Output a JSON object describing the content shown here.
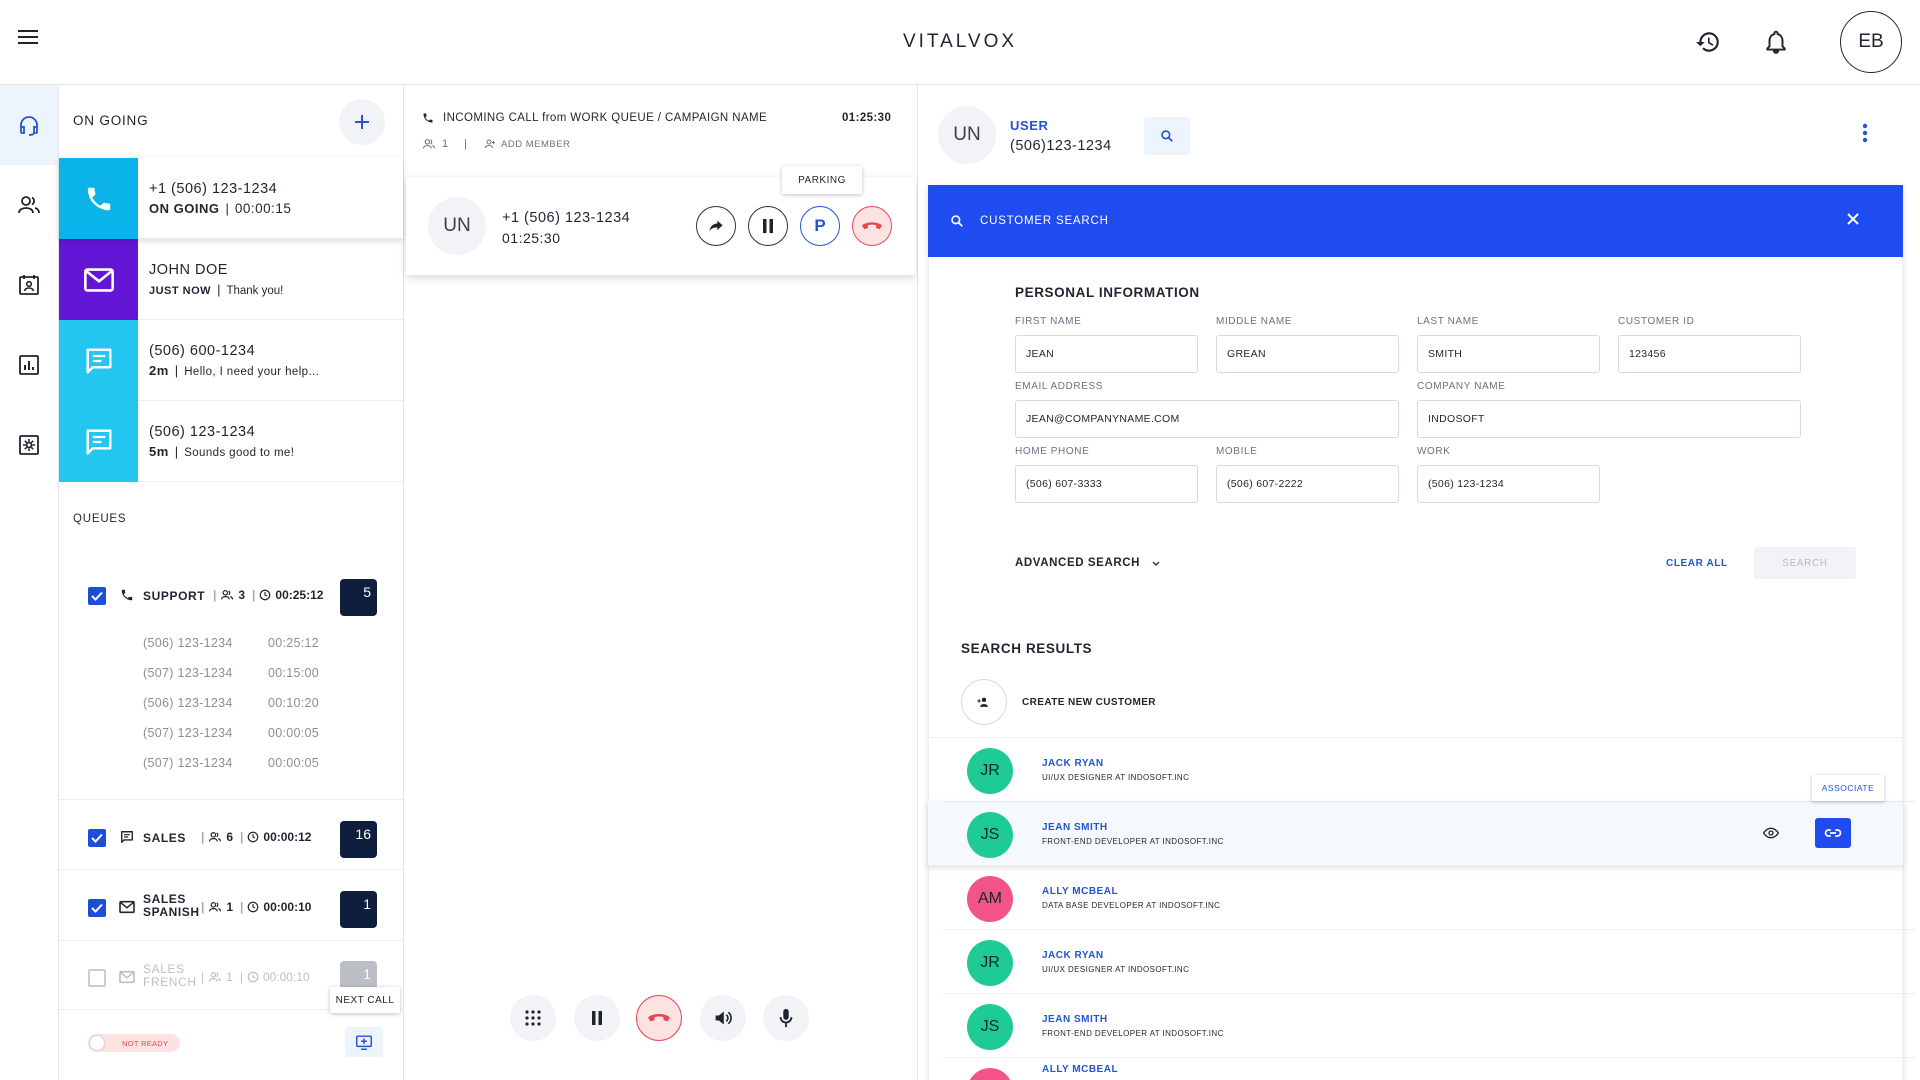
{
  "app": {
    "brand": "VITALVOX",
    "user_initials": "EB"
  },
  "ongoing": {
    "title": "ON GOING",
    "conversations": [
      {
        "channel": "phone-icon",
        "color": "#0ab4ea",
        "line1": "+1 (506) 123-1234",
        "time": "ON GOING",
        "text": "00:00:15"
      },
      {
        "channel": "mail-icon",
        "color": "#6216d6",
        "line1": "JOHN DOE",
        "time": "JUST NOW",
        "text": "Thank you!"
      },
      {
        "channel": "chat-icon",
        "color": "#22c6ee",
        "line1": "(506) 600-1234",
        "time": "2m",
        "text": "Hello, I need your help..."
      },
      {
        "channel": "chat-icon",
        "color": "#22c6ee",
        "line1": "(506) 123-1234",
        "time": "5m",
        "text": "Sounds good to me!"
      }
    ],
    "queues_title": "QUEUES",
    "queues": [
      {
        "name": "SUPPORT",
        "agents": "3",
        "wait": "00:25:12",
        "count": "5",
        "checked": true,
        "calls": [
          {
            "number": "(506) 123-1234",
            "time": "00:25:12"
          },
          {
            "number": "(507) 123-1234",
            "time": "00:15:00"
          },
          {
            "number": "(506) 123-1234",
            "time": "00:10:20"
          },
          {
            "number": "(507) 123-1234",
            "time": "00:00:05"
          },
          {
            "number": "(507) 123-1234",
            "time": "00:00:05"
          }
        ]
      },
      {
        "name": "SALES",
        "agents": "6",
        "wait": "00:00:12",
        "count": "16",
        "checked": true
      },
      {
        "name_line1": "SALES",
        "name_line2": "SPANISH",
        "agents": "1",
        "wait": "00:00:10",
        "count": "1",
        "checked": true
      },
      {
        "name_line1": "SALES",
        "name_line2": "FRENCH",
        "agents": "1",
        "wait": "00:00:10",
        "count": "1",
        "checked": false
      }
    ],
    "status_toggle": "NOT READY",
    "next_call_tooltip": "NEXT CALL"
  },
  "call": {
    "header": "INCOMING CALL from WORK QUEUE / CAMPAIGN NAME",
    "header_time": "01:25:30",
    "member_count": "1",
    "add_member": "ADD MEMBER",
    "caller_initials": "UN",
    "caller_number": "+1 (506) 123-1234",
    "caller_time": "01:25:30",
    "parking_tooltip": "PARKING",
    "parking_label": "P"
  },
  "customer": {
    "initials": "UN",
    "user_label": "USER",
    "phone": "(506)123-1234",
    "search_bar_title": "CUSTOMER SEARCH",
    "section_title": "PERSONAL INFORMATION",
    "fields": {
      "first_name": {
        "label": "FIRST NAME",
        "value": "JEAN"
      },
      "middle_name": {
        "label": "MIDDLE NAME",
        "value": "GREAN"
      },
      "last_name": {
        "label": "LAST NAME",
        "value": "SMITH"
      },
      "customer_id": {
        "label": "CUSTOMER ID",
        "value": "123456"
      },
      "email": {
        "label": "EMAIL ADDRESS",
        "value": "JEAN@COMPANYNAME.COM"
      },
      "company": {
        "label": "COMPANY NAME",
        "value": "INDOSOFT"
      },
      "home_phone": {
        "label": "HOME PHONE",
        "value": "(506) 607-3333"
      },
      "mobile": {
        "label": "MOBILE",
        "value": "(506) 607-2222"
      },
      "work": {
        "label": "WORK",
        "value": "(506) 123-1234"
      }
    },
    "advanced_search": "ADVANCED SEARCH",
    "clear_all": "CLEAR ALL",
    "search_button": "SEARCH",
    "results_title": "SEARCH RESULTS",
    "create_new": "CREATE NEW CUSTOMER",
    "associate_tooltip": "ASSOCIATE",
    "results": [
      {
        "initials": "JR",
        "name": "JACK RYAN",
        "role": "UI/UX DESIGNER AT INDOSOFT.INC",
        "color": "#1ecb95"
      },
      {
        "initials": "JS",
        "name": "JEAN SMITH",
        "role": "FRONT-END DEVELOPER AT INDOSOFT.INC",
        "color": "#1ecb95"
      },
      {
        "initials": "AM",
        "name": "ALLY MCBEAL",
        "role": "DATA BASE DEVELOPER AT INDOSOFT.INC",
        "color": "#f2548a"
      },
      {
        "initials": "JR",
        "name": "JACK RYAN",
        "role": "UI/UX DESIGNER AT INDOSOFT.INC",
        "color": "#1ecb95"
      },
      {
        "initials": "JS",
        "name": "JEAN SMITH",
        "role": "FRONT-END DEVELOPER AT INDOSOFT.INC",
        "color": "#1ecb95"
      },
      {
        "initials": "",
        "name": "ALLY MCBEAL",
        "role": "",
        "color": "#f2548a"
      }
    ]
  }
}
